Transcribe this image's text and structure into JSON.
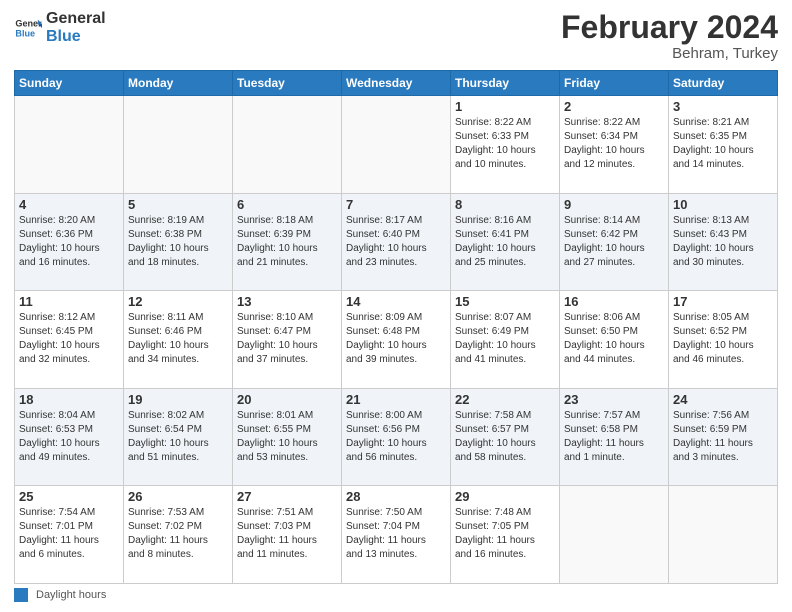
{
  "header": {
    "logo_line1": "General",
    "logo_line2": "Blue",
    "month_title": "February 2024",
    "location": "Behram, Turkey"
  },
  "weekdays": [
    "Sunday",
    "Monday",
    "Tuesday",
    "Wednesday",
    "Thursday",
    "Friday",
    "Saturday"
  ],
  "weeks": [
    [
      {
        "day": "",
        "info": ""
      },
      {
        "day": "",
        "info": ""
      },
      {
        "day": "",
        "info": ""
      },
      {
        "day": "",
        "info": ""
      },
      {
        "day": "1",
        "info": "Sunrise: 8:22 AM\nSunset: 6:33 PM\nDaylight: 10 hours\nand 10 minutes."
      },
      {
        "day": "2",
        "info": "Sunrise: 8:22 AM\nSunset: 6:34 PM\nDaylight: 10 hours\nand 12 minutes."
      },
      {
        "day": "3",
        "info": "Sunrise: 8:21 AM\nSunset: 6:35 PM\nDaylight: 10 hours\nand 14 minutes."
      }
    ],
    [
      {
        "day": "4",
        "info": "Sunrise: 8:20 AM\nSunset: 6:36 PM\nDaylight: 10 hours\nand 16 minutes."
      },
      {
        "day": "5",
        "info": "Sunrise: 8:19 AM\nSunset: 6:38 PM\nDaylight: 10 hours\nand 18 minutes."
      },
      {
        "day": "6",
        "info": "Sunrise: 8:18 AM\nSunset: 6:39 PM\nDaylight: 10 hours\nand 21 minutes."
      },
      {
        "day": "7",
        "info": "Sunrise: 8:17 AM\nSunset: 6:40 PM\nDaylight: 10 hours\nand 23 minutes."
      },
      {
        "day": "8",
        "info": "Sunrise: 8:16 AM\nSunset: 6:41 PM\nDaylight: 10 hours\nand 25 minutes."
      },
      {
        "day": "9",
        "info": "Sunrise: 8:14 AM\nSunset: 6:42 PM\nDaylight: 10 hours\nand 27 minutes."
      },
      {
        "day": "10",
        "info": "Sunrise: 8:13 AM\nSunset: 6:43 PM\nDaylight: 10 hours\nand 30 minutes."
      }
    ],
    [
      {
        "day": "11",
        "info": "Sunrise: 8:12 AM\nSunset: 6:45 PM\nDaylight: 10 hours\nand 32 minutes."
      },
      {
        "day": "12",
        "info": "Sunrise: 8:11 AM\nSunset: 6:46 PM\nDaylight: 10 hours\nand 34 minutes."
      },
      {
        "day": "13",
        "info": "Sunrise: 8:10 AM\nSunset: 6:47 PM\nDaylight: 10 hours\nand 37 minutes."
      },
      {
        "day": "14",
        "info": "Sunrise: 8:09 AM\nSunset: 6:48 PM\nDaylight: 10 hours\nand 39 minutes."
      },
      {
        "day": "15",
        "info": "Sunrise: 8:07 AM\nSunset: 6:49 PM\nDaylight: 10 hours\nand 41 minutes."
      },
      {
        "day": "16",
        "info": "Sunrise: 8:06 AM\nSunset: 6:50 PM\nDaylight: 10 hours\nand 44 minutes."
      },
      {
        "day": "17",
        "info": "Sunrise: 8:05 AM\nSunset: 6:52 PM\nDaylight: 10 hours\nand 46 minutes."
      }
    ],
    [
      {
        "day": "18",
        "info": "Sunrise: 8:04 AM\nSunset: 6:53 PM\nDaylight: 10 hours\nand 49 minutes."
      },
      {
        "day": "19",
        "info": "Sunrise: 8:02 AM\nSunset: 6:54 PM\nDaylight: 10 hours\nand 51 minutes."
      },
      {
        "day": "20",
        "info": "Sunrise: 8:01 AM\nSunset: 6:55 PM\nDaylight: 10 hours\nand 53 minutes."
      },
      {
        "day": "21",
        "info": "Sunrise: 8:00 AM\nSunset: 6:56 PM\nDaylight: 10 hours\nand 56 minutes."
      },
      {
        "day": "22",
        "info": "Sunrise: 7:58 AM\nSunset: 6:57 PM\nDaylight: 10 hours\nand 58 minutes."
      },
      {
        "day": "23",
        "info": "Sunrise: 7:57 AM\nSunset: 6:58 PM\nDaylight: 11 hours\nand 1 minute."
      },
      {
        "day": "24",
        "info": "Sunrise: 7:56 AM\nSunset: 6:59 PM\nDaylight: 11 hours\nand 3 minutes."
      }
    ],
    [
      {
        "day": "25",
        "info": "Sunrise: 7:54 AM\nSunset: 7:01 PM\nDaylight: 11 hours\nand 6 minutes."
      },
      {
        "day": "26",
        "info": "Sunrise: 7:53 AM\nSunset: 7:02 PM\nDaylight: 11 hours\nand 8 minutes."
      },
      {
        "day": "27",
        "info": "Sunrise: 7:51 AM\nSunset: 7:03 PM\nDaylight: 11 hours\nand 11 minutes."
      },
      {
        "day": "28",
        "info": "Sunrise: 7:50 AM\nSunset: 7:04 PM\nDaylight: 11 hours\nand 13 minutes."
      },
      {
        "day": "29",
        "info": "Sunrise: 7:48 AM\nSunset: 7:05 PM\nDaylight: 11 hours\nand 16 minutes."
      },
      {
        "day": "",
        "info": ""
      },
      {
        "day": "",
        "info": ""
      }
    ]
  ],
  "footer": {
    "legend_label": "Daylight hours"
  }
}
